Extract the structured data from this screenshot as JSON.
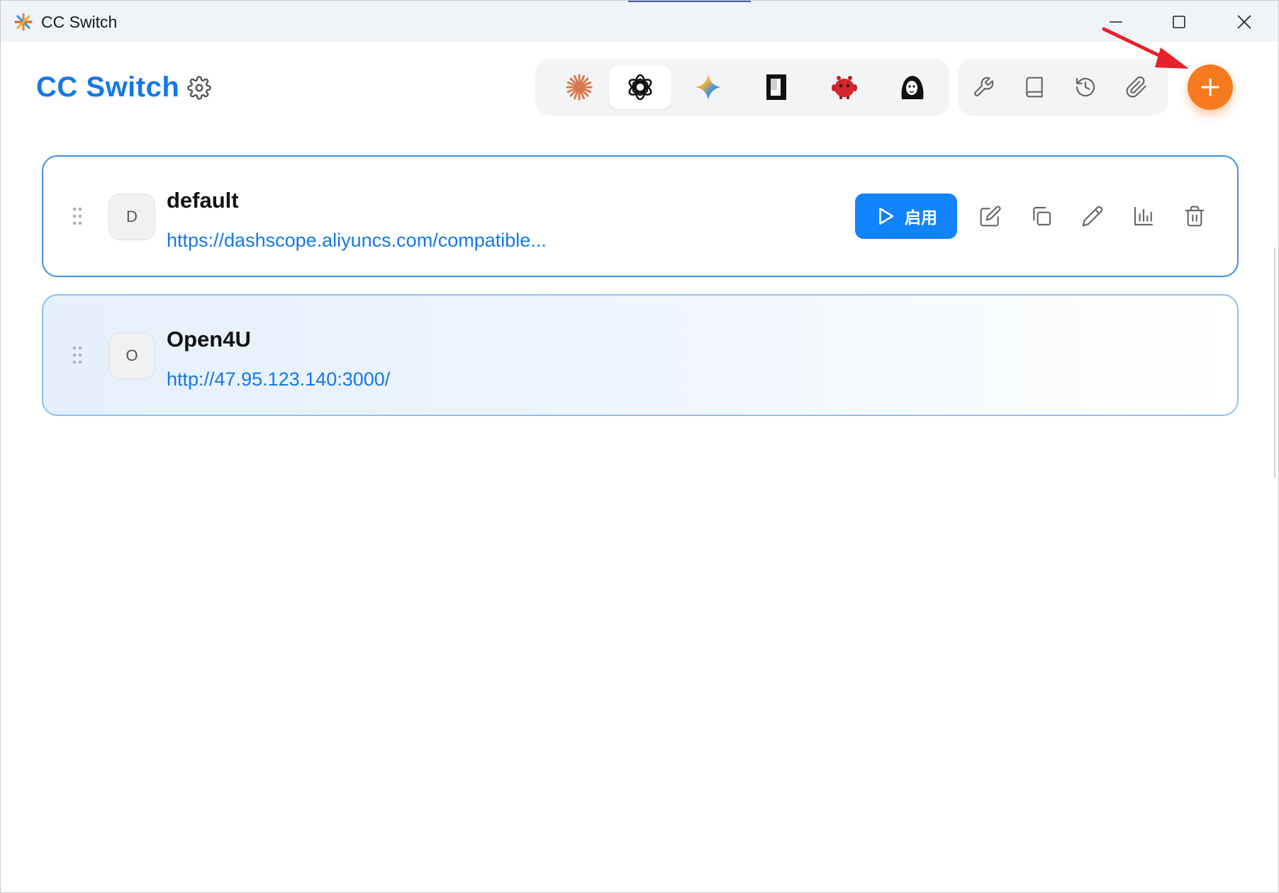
{
  "window": {
    "title": "CC Switch"
  },
  "header": {
    "brand": "CC Switch"
  },
  "app_tabs": [
    {
      "name": "claude",
      "active": false
    },
    {
      "name": "openai",
      "active": true
    },
    {
      "name": "gemini",
      "active": false
    },
    {
      "name": "terminal",
      "active": false
    },
    {
      "name": "red-bot",
      "active": false
    },
    {
      "name": "character",
      "active": false
    }
  ],
  "tools": [
    "wrench-icon",
    "book-icon",
    "history-icon",
    "paperclip-icon"
  ],
  "providers": [
    {
      "initial": "D",
      "name": "default",
      "url": "https://dashscope.aliyuncs.com/compatible...",
      "active": true,
      "enable_label": "启用"
    },
    {
      "initial": "O",
      "name": "Open4U",
      "url": "http://47.95.123.140:3000/",
      "active": false
    }
  ],
  "colors": {
    "brand": "#1478e6",
    "add_button": "#f77a1f",
    "enable_button": "#1283ff",
    "annotation_arrow": "#e8202a"
  }
}
